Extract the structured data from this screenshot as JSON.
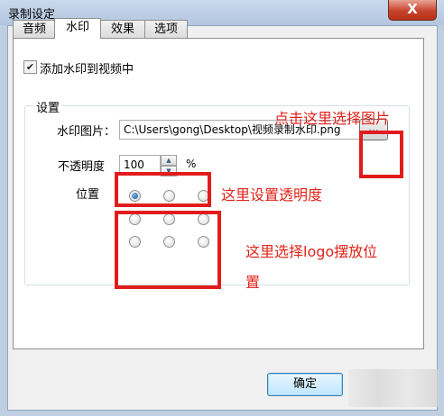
{
  "window": {
    "title": "录制设定",
    "close_glyph": "X"
  },
  "tabs": [
    {
      "label": "音频",
      "active": false
    },
    {
      "label": "水印",
      "active": true
    },
    {
      "label": "效果",
      "active": false
    },
    {
      "label": "选项",
      "active": false
    }
  ],
  "watermark": {
    "add_checkbox_label": "添加水印到视频中",
    "add_checkbox_checked": true,
    "settings_group_title": "设置",
    "image_label": "水印图片：",
    "image_path": "C:\\Users\\gong\\Desktop\\视频录制水印.png",
    "browse_label": "...",
    "opacity_label": "不透明度",
    "opacity_value": "100",
    "opacity_unit": "%",
    "position_label": "位置",
    "position_selected_index": 0
  },
  "annotations": {
    "browse_hint": "点击这里选择图片",
    "opacity_hint": "这里设置透明度",
    "position_hint_line1": "这里选择logo摆放位",
    "position_hint_line2": "置",
    "highlight_color": "#e21c1c"
  },
  "footer": {
    "ok_label": "确定"
  }
}
